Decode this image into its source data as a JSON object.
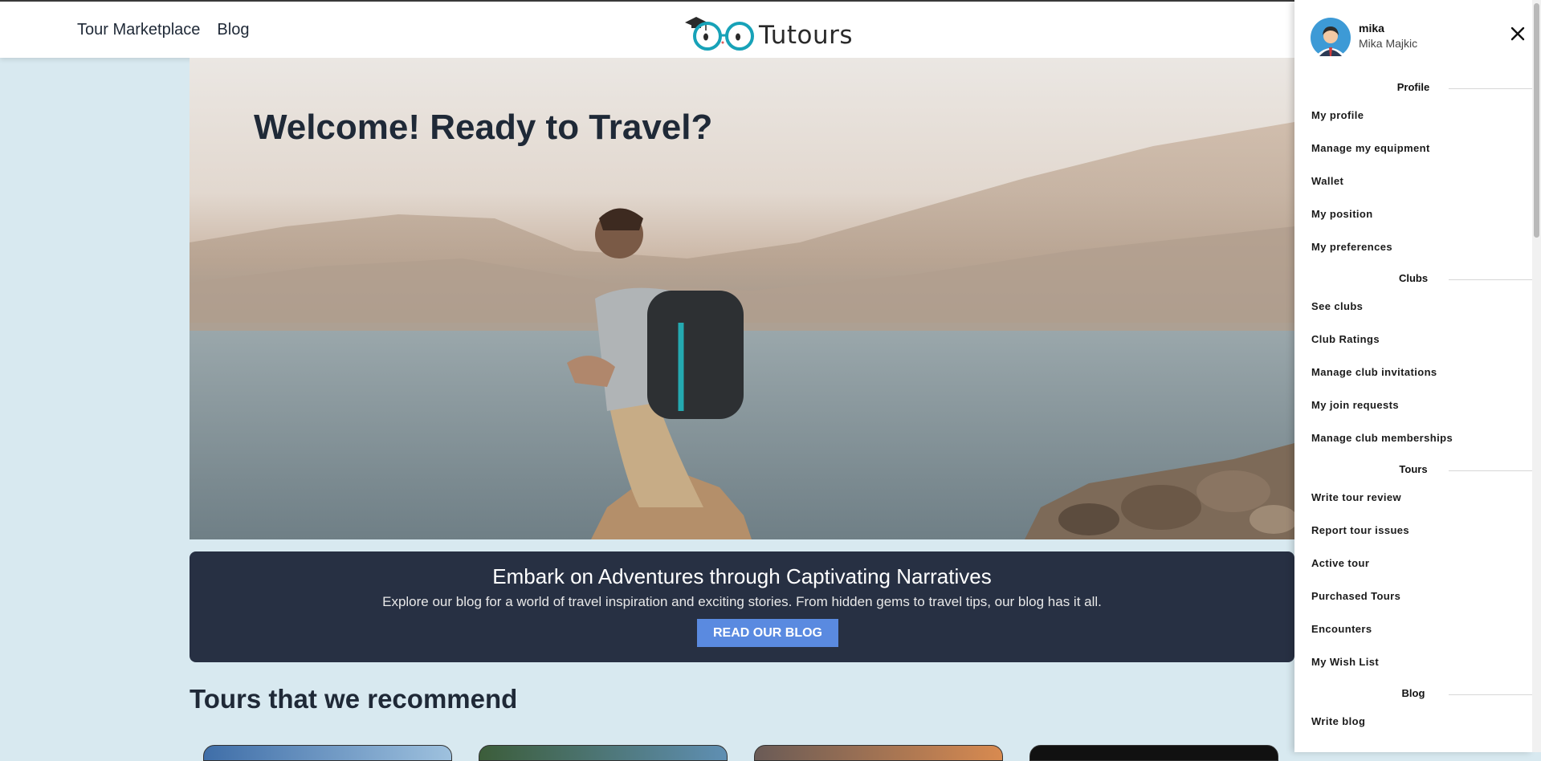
{
  "header": {
    "nav": [
      "Tour Marketplace",
      "Blog"
    ],
    "logo_text": "Tutours"
  },
  "hero": {
    "title": "Welcome! Ready to Travel?"
  },
  "banner": {
    "title": "Embark on Adventures through Captivating Narratives",
    "text": "Explore our blog for a world of travel inspiration and exciting stories. From hidden gems to travel tips, our blog has it all.",
    "button": "READ OUR BLOG"
  },
  "recommend": {
    "title": "Tours that we recommend"
  },
  "drawer": {
    "username": "mika",
    "fullname": "Mika Majkic",
    "sections": [
      {
        "title": "Profile",
        "items": [
          "My profile",
          "Manage my equipment",
          "Wallet",
          "My position",
          "My preferences"
        ]
      },
      {
        "title": "Clubs",
        "items": [
          "See clubs",
          "Club Ratings",
          "Manage club invitations",
          "My join requests",
          "Manage club memberships"
        ]
      },
      {
        "title": "Tours",
        "items": [
          "Write tour review",
          "Report tour issues",
          "Active tour",
          "Purchased Tours",
          "Encounters",
          "My Wish List"
        ]
      },
      {
        "title": "Blog",
        "items": [
          "Write blog"
        ]
      }
    ]
  },
  "colors": {
    "page_bg": "#d8e9f0",
    "banner_bg": "#273043",
    "button_bg": "#5a8ae0",
    "logo_accent": "#17a2b8"
  },
  "icons": {
    "close": "close-icon",
    "avatar": "user-avatar-icon",
    "logo": "glasses-graduation-cap-icon"
  }
}
